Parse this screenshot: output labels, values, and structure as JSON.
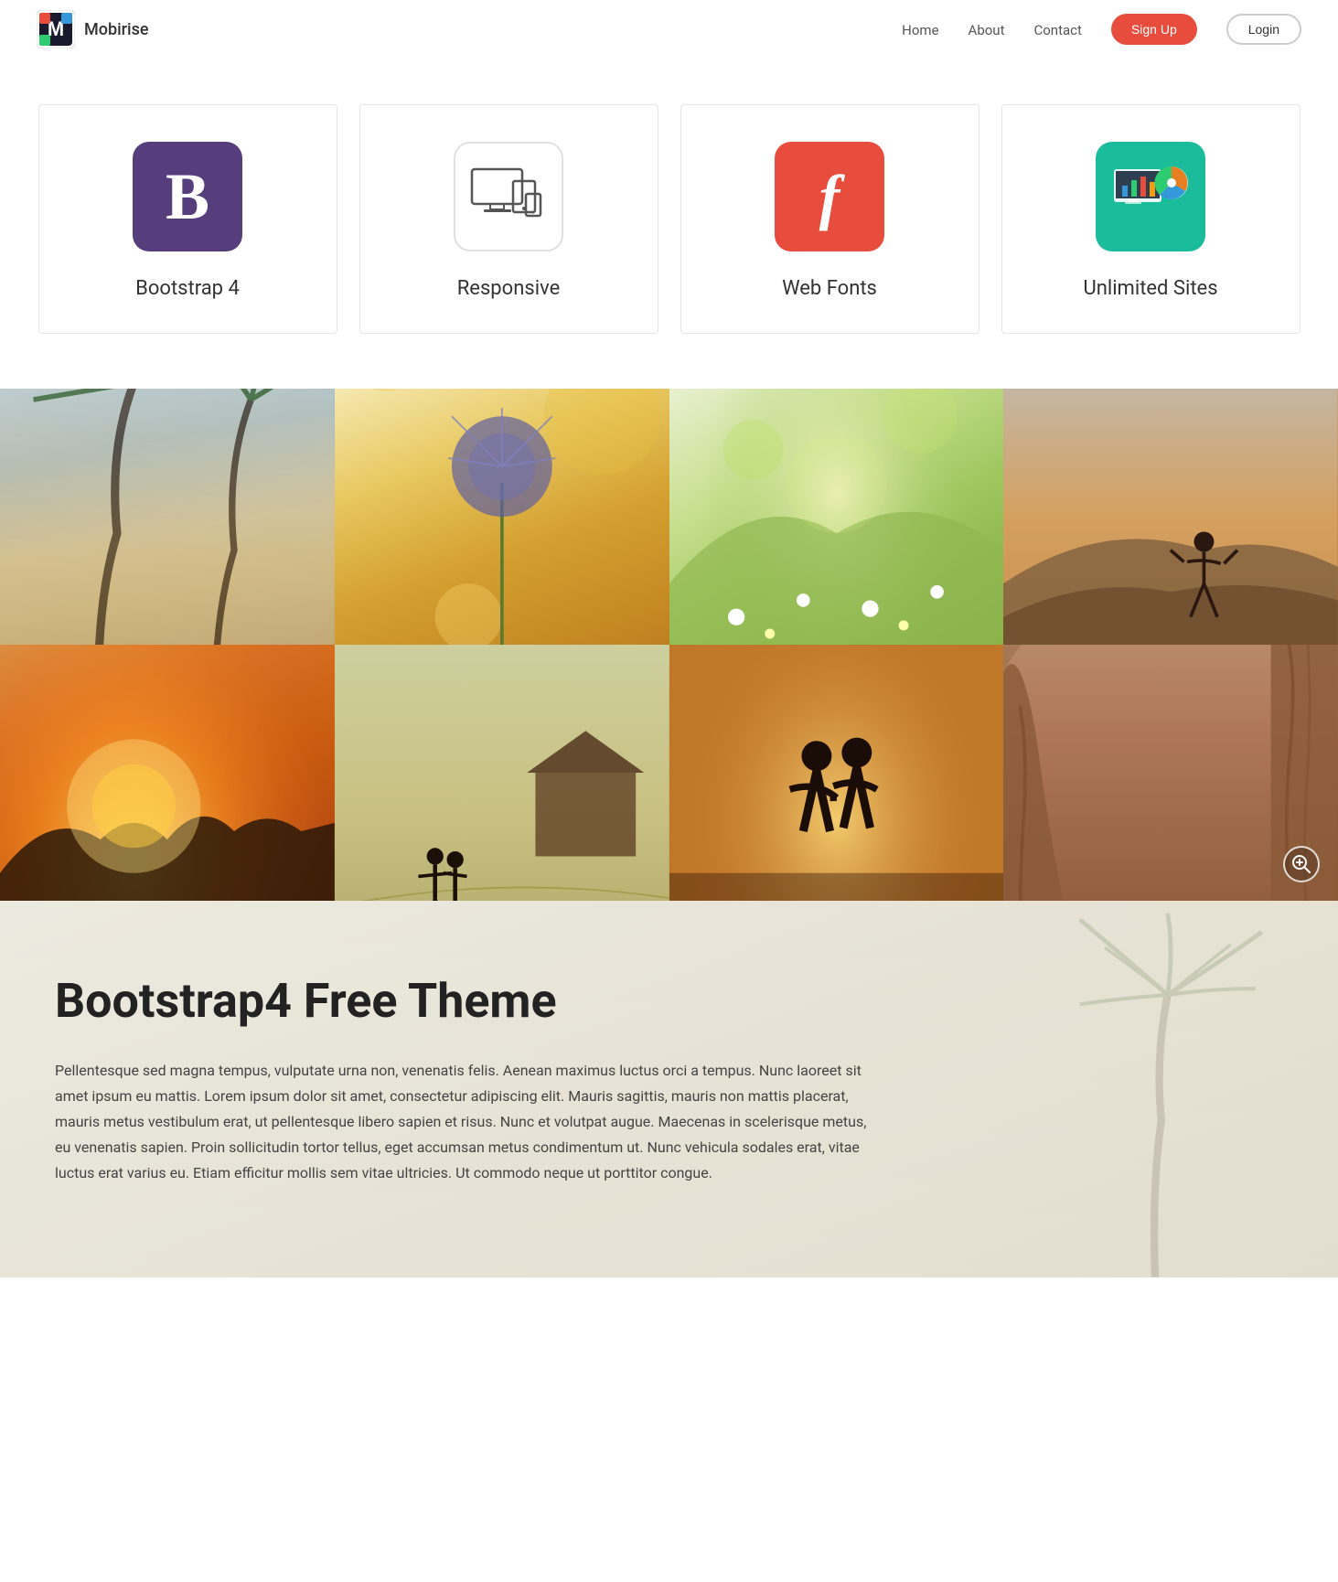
{
  "brand": {
    "name": "Mobirise",
    "logo_text": "M"
  },
  "nav": {
    "links": [
      {
        "id": "home",
        "label": "Home"
      },
      {
        "id": "about",
        "label": "About"
      },
      {
        "id": "contact",
        "label": "Contact"
      }
    ],
    "signup_label": "Sign Up",
    "login_label": "Login"
  },
  "features": {
    "cards": [
      {
        "id": "bootstrap",
        "icon_type": "bootstrap",
        "title": "Bootstrap 4"
      },
      {
        "id": "responsive",
        "icon_type": "responsive",
        "title": "Responsive"
      },
      {
        "id": "webfonts",
        "icon_type": "webfonts",
        "title": "Web Fonts"
      },
      {
        "id": "unlimited",
        "icon_type": "unlimited",
        "title": "Unlimited Sites"
      }
    ]
  },
  "photos": {
    "grid": [
      {
        "id": 1,
        "class": "photo-1",
        "alt": "Palm trees beach"
      },
      {
        "id": 2,
        "class": "photo-2",
        "alt": "Dandelion flower"
      },
      {
        "id": 3,
        "class": "photo-3",
        "alt": "Meadow flowers"
      },
      {
        "id": 4,
        "class": "photo-4",
        "alt": "Person on hill"
      },
      {
        "id": 5,
        "class": "photo-5",
        "alt": "Sunset"
      },
      {
        "id": 6,
        "class": "photo-6",
        "alt": "Couple field"
      },
      {
        "id": 7,
        "class": "photo-7",
        "alt": "Couple sunset"
      },
      {
        "id": 8,
        "class": "photo-8",
        "alt": "Canyon rocks"
      }
    ],
    "zoom_icon": "⊕"
  },
  "content": {
    "heading": "Bootstrap4 Free Theme",
    "body": "Pellentesque sed magna tempus, vulputate urna non, venenatis felis. Aenean maximus luctus orci a tempus. Nunc laoreet sit amet ipsum eu mattis. Lorem ipsum dolor sit amet, consectetur adipiscing elit. Mauris sagittis, mauris non mattis placerat, mauris metus vestibulum erat, ut pellentesque libero sapien et risus. Nunc et volutpat augue. Maecenas in scelerisque metus, eu venenatis sapien. Proin sollicitudin tortor tellus, eget accumsan metus condimentum ut. Nunc vehicula sodales erat, vitae luctus erat varius eu. Etiam efficitur mollis sem vitae ultricies. Ut commodo neque ut porttitor congue."
  },
  "colors": {
    "brand_red": "#e74c3c",
    "brand_teal": "#1abc9c",
    "bootstrap_purple": "#563d7c"
  }
}
